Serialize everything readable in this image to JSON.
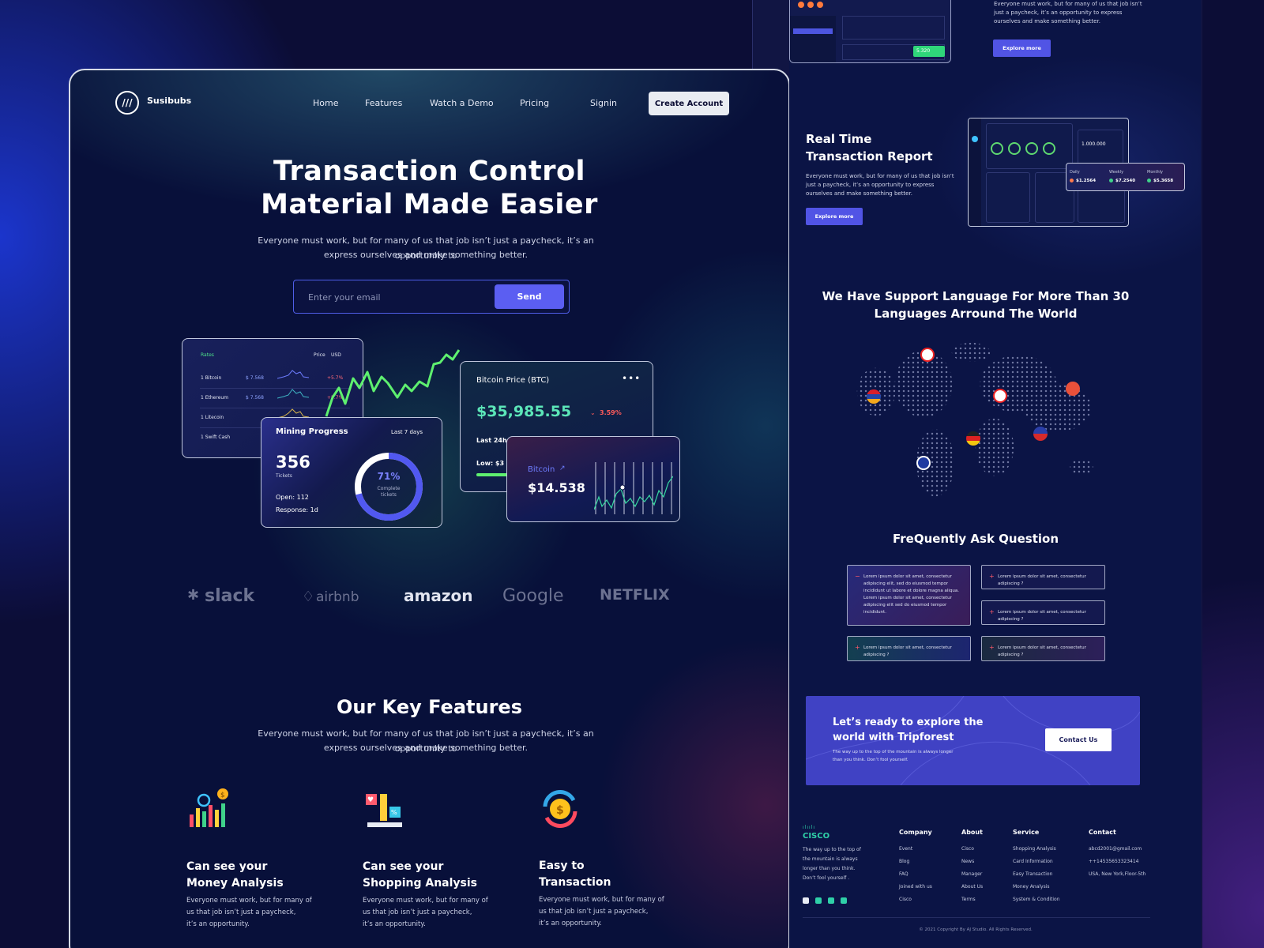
{
  "nav": {
    "brand": "Susibubs",
    "links": [
      "Home",
      "Features",
      "Watch a Demo",
      "Pricing"
    ],
    "signin": "Signin",
    "create": "Create Account"
  },
  "hero": {
    "title_line1": "Transaction Control",
    "title_line2": "Material Made Easier",
    "subtitle_line1": "Everyone must work, but for many of us that job isn’t just a paycheck, it’s an opportunity to",
    "subtitle_line2": "express ourselves and make something better.",
    "email_placeholder": "Enter your email",
    "send": "Send"
  },
  "rates_card": {
    "title": "Rates",
    "price": "Price",
    "currency": "USD",
    "rows": [
      {
        "name": "1 Bitcoin",
        "value": "$ 7.568",
        "change": "+5.7%"
      },
      {
        "name": "1 Ethereum",
        "value": "$ 7.568",
        "change": "+5.7%"
      },
      {
        "name": "1 Litecoin",
        "value": "$ 7.568",
        "change": ""
      },
      {
        "name": "1 Swift Cash",
        "value": "$ 7.568",
        "change": ""
      }
    ]
  },
  "mining_card": {
    "title": "Mining Progress",
    "period": "Last 7 days",
    "count": "356",
    "count_label": "Tickets",
    "open": "Open: 112",
    "response": "Response: 1d",
    "percent_label": "71%",
    "percent": 0.71,
    "complete_line1": "Complete",
    "complete_line2": "tickets"
  },
  "btc_card": {
    "title": "Bitcoin Price (BTC)",
    "price": "$35,985.55",
    "change": "3.59%",
    "last": "Last 24h",
    "low": "Low: $3"
  },
  "btc2_card": {
    "label": "Bitcoin",
    "value": "$14.538"
  },
  "brands": [
    "slack",
    "airbnb",
    "amazon",
    "Google",
    "NETFLIX"
  ],
  "features": {
    "title": "Our Key Features",
    "subtitle_line1": "Everyone must work, but for many of us that job isn’t just a paycheck, it’s an opportunity to",
    "subtitle_line2": "express ourselves and make something better.",
    "items": [
      {
        "h1": "Can see your",
        "h2": "Money Analysis",
        "p1": "Everyone must work, but for many of",
        "p2": "us that job isn’t just a paycheck,",
        "p3": "it’s an opportunity."
      },
      {
        "h1": "Can see your",
        "h2": "Shopping Analysis",
        "p1": "Everyone must work, but for many of",
        "p2": "us that job isn’t just a paycheck,",
        "p3": "it’s an opportunity."
      },
      {
        "h1": "Easy to",
        "h2": "Transaction",
        "p1": "Everyone must work, but for many of",
        "p2": "us that job isn’t just a paycheck,",
        "p3": "it’s an opportunity."
      }
    ]
  },
  "right": {
    "top_text_line1": "Everyone must work, but for many of us that job isn’t",
    "top_text_line2": "just a paycheck, it’s an opportunity to express",
    "top_text_line3": "ourselves and make something better.",
    "explore": "Explore more",
    "mini_badge": "5.320",
    "report": {
      "title_line1": "Real Time",
      "title_line2": "Transaction Report",
      "text_line1": "Everyone must work, but for many of us that job isn’t",
      "text_line2": "just a paycheck, it’s an opportunity to express",
      "text_line3": "ourselves and make something better.",
      "explore": "Explore more",
      "balance": "1.000.000",
      "daily": "$1.2564",
      "weekly": "$7.2540",
      "monthly": "$5.3658",
      "daily_label": "Daily",
      "weekly_label": "Weekly",
      "monthly_label": "Monthly"
    },
    "language": {
      "title_line1": "We Have Support Language For More Than 30",
      "title_line2": "Languages Arround The World"
    },
    "faq": {
      "title": "FreQuently Ask Question",
      "open_text": "Lorem ipsum dolor sit amet, consectetur adipiscing elit, sed do eiusmod tempor incididunt ut labore et dolore magna aliqua. Lorem ipsum dolor sit amet, consectetur adipiscing elit sed do eiusmod tempor incididunt.",
      "item": "Lorem ipsum dolor sit amet, consectetur adipiscing ?"
    },
    "cta": {
      "title_line1": "Let’s ready to explore the",
      "title_line2": "world with Tripforest",
      "text_line1": "The way up to the top of the mountain is always longer",
      "text_line2": "than you think. Don’t fool yourself.",
      "button": "Contact Us"
    },
    "footer": {
      "logo": "CISCO",
      "about_line1": "The way up to the top of",
      "about_line2": "the mountain is always",
      "about_line3": "longer than you think.",
      "about_line4": "Don’t fool yourself .",
      "cols": [
        {
          "title": "Company",
          "items": [
            "Event",
            "Blog",
            "FAQ",
            "Joined with us",
            "Cisco"
          ]
        },
        {
          "title": "About",
          "items": [
            "Cisco",
            "News",
            "Manager",
            "About Us",
            "Terms"
          ]
        },
        {
          "title": "Service",
          "items": [
            "Shopping Analysis",
            "Card Information",
            "Easy Transaction",
            "Money Analysis",
            "System & Condition"
          ]
        },
        {
          "title": "Contact",
          "items": [
            "abcd2001@gmail.com",
            "++14535653323414",
            "USA, New York,Floor-5th"
          ]
        }
      ],
      "copyright": "© 2021 Copyright By AJ Studio. All Rights Reserved."
    }
  }
}
